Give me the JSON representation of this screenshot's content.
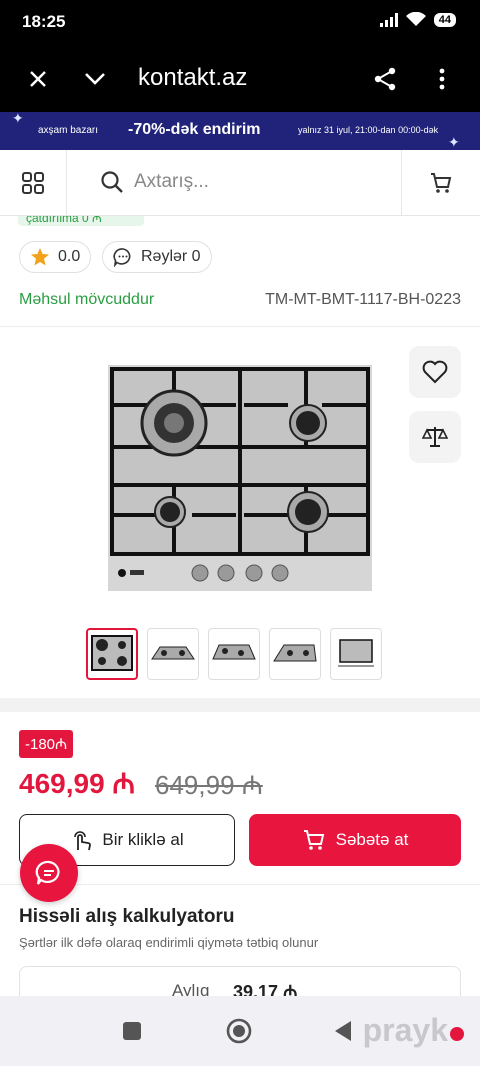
{
  "status_bar": {
    "time": "18:25",
    "battery": "44"
  },
  "browser": {
    "url": "kontakt.az"
  },
  "promo": {
    "left_text": "axşam bazarı",
    "main_text": "-70%-dək endirim",
    "right_text": "yalnız 31 iyul, 21:00-dan 00:00-dək"
  },
  "search": {
    "placeholder": "Axtarış..."
  },
  "product": {
    "cut_text": "çatdırılma 0 ₼",
    "rating": "0.0",
    "reviews_label": "Rəylər 0",
    "availability": "Məhsul mövcuddur",
    "sku": "TM-MT-BMT-1117-BH-0223",
    "thumbnail_count": 5
  },
  "pricing": {
    "discount_badge": "-180₼",
    "price": "469,99 ₼",
    "old_price": "649,99 ₼"
  },
  "actions": {
    "one_click": "Bir kliklə al",
    "add_to_cart": "Səbətə at"
  },
  "calculator": {
    "title": "Hissəli alış kalkulyatoru",
    "subtitle": "Şərtlər ilk dəfə olaraq endirimli qiymətə tətbiq olunur",
    "monthly_label": "Aylıq",
    "monthly_value": "39.17 ₼"
  },
  "watermark": "prayk",
  "colors": {
    "brand_red": "#e8153f",
    "promo_blue": "#21237a",
    "green": "#2a9d43"
  }
}
